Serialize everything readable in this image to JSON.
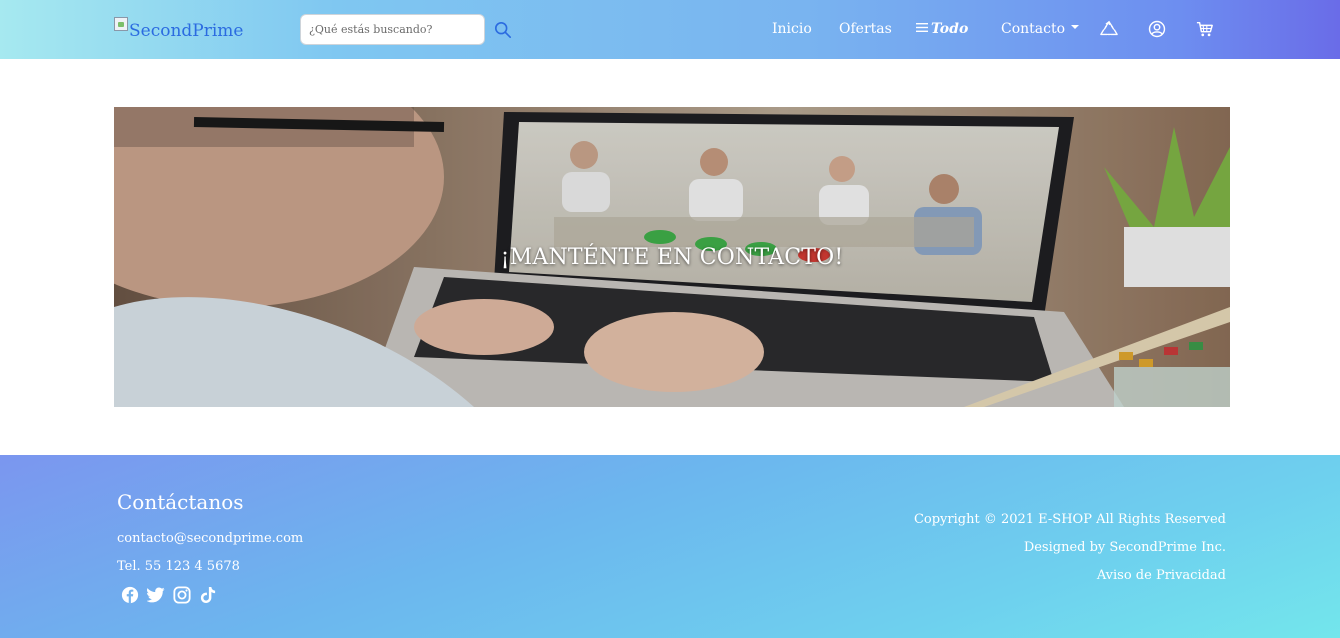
{
  "navbar": {
    "logo_alt": "SecondPrime",
    "search_placeholder": "¿Qué estás buscando?",
    "links": {
      "inicio": "Inicio",
      "ofertas": "Ofertas",
      "todo": "Todo",
      "contacto": "Contacto"
    },
    "icons": [
      "search-icon",
      "recycle-icon",
      "user-circle-icon",
      "cart-icon"
    ]
  },
  "hero": {
    "title": "¡MANTÉNTE EN CONTACTO!"
  },
  "footer": {
    "heading": "Contáctanos",
    "email": "contacto@secondprime.com",
    "phone": "Tel. 55 123 4 5678",
    "copyright": "Copyright © 2021 E-SHOP All Rights Reserved",
    "designed_by": "Designed by SecondPrime Inc.",
    "privacy": "Aviso de Privacidad",
    "social": [
      "facebook-icon",
      "twitter-icon",
      "instagram-icon",
      "tiktok-icon"
    ]
  },
  "colors": {
    "accent": "#2b6be0",
    "nav_gradient_start": "#a6e9f0",
    "nav_gradient_end": "#6a6ce8",
    "footer_gradient_start": "#7b96ef",
    "footer_gradient_end": "#73e6ec"
  }
}
